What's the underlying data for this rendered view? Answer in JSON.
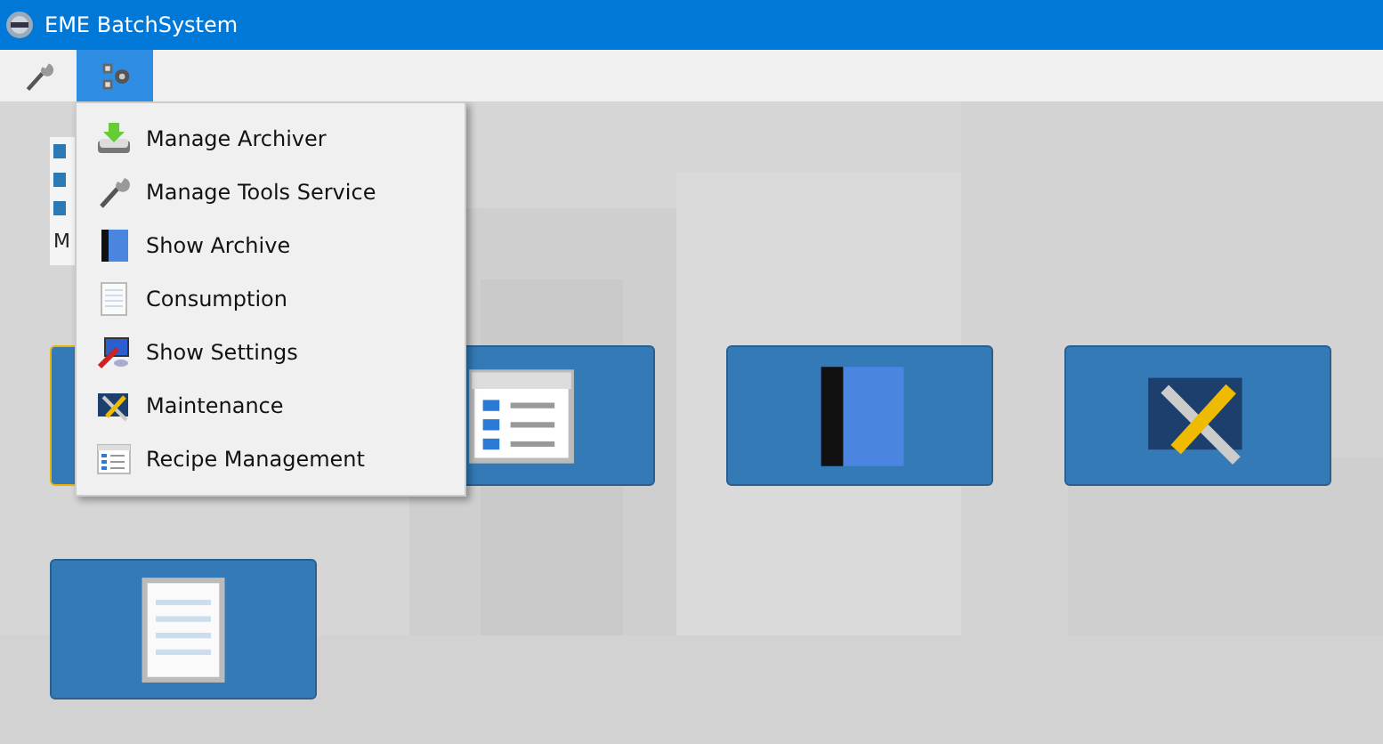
{
  "window": {
    "title": "EME BatchSystem"
  },
  "toolbar": [
    {
      "kind": "wrench",
      "selected": false
    },
    {
      "kind": "gears",
      "selected": true
    }
  ],
  "background_card": {
    "text": "M"
  },
  "tiles": [
    {
      "kind": "blank",
      "selected": true
    },
    {
      "kind": "window",
      "selected": false
    },
    {
      "kind": "book",
      "selected": false
    },
    {
      "kind": "tools",
      "selected": false
    },
    {
      "kind": "document",
      "selected": false
    }
  ],
  "menu": {
    "items": [
      {
        "label": "Manage Archiver",
        "kind": "archiver"
      },
      {
        "label": "Manage Tools Service",
        "kind": "wrench"
      },
      {
        "label": "Show Archive",
        "kind": "book"
      },
      {
        "label": "Consumption",
        "kind": "document"
      },
      {
        "label": "Show Settings",
        "kind": "settings"
      },
      {
        "label": "Maintenance",
        "kind": "tools"
      },
      {
        "label": "Recipe Management",
        "kind": "window"
      }
    ]
  }
}
